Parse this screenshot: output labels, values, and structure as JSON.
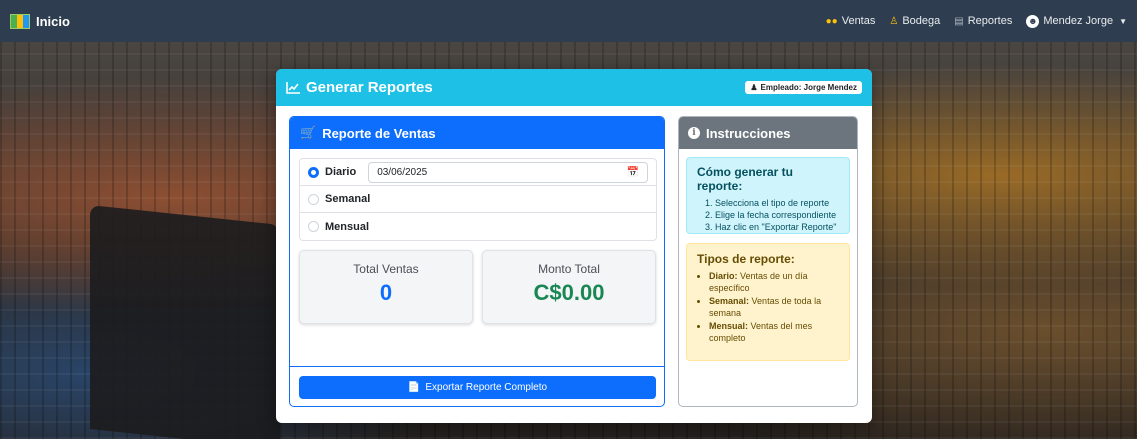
{
  "navbar": {
    "brand": "Inicio",
    "links": [
      {
        "label": "Ventas",
        "icon": "coins-icon"
      },
      {
        "label": "Bodega",
        "icon": "person-icon"
      },
      {
        "label": "Reportes",
        "icon": "chart-icon"
      }
    ],
    "user": "Mendez Jorge"
  },
  "card": {
    "title": "Generar Reportes",
    "employee_badge": "Empleado: Jorge Mendez"
  },
  "sales": {
    "title": "Reporte de Ventas",
    "options": [
      {
        "label": "Diario",
        "checked": true
      },
      {
        "label": "Semanal",
        "checked": false
      },
      {
        "label": "Mensual",
        "checked": false
      }
    ],
    "date_value": "03/06/2025",
    "total_label": "Total Ventas",
    "total_value": "0",
    "amount_label": "Monto Total",
    "amount_value": "C$0.00",
    "export_label": "Exportar Reporte Completo"
  },
  "instructions": {
    "title": "Instrucciones",
    "how_title": "Cómo generar tu reporte:",
    "steps": [
      "Selecciona el tipo de reporte",
      "Elige la fecha correspondiente",
      "Haz clic en \"Exportar Reporte\""
    ],
    "types_title": "Tipos de reporte:",
    "types": [
      {
        "name": "Diario:",
        "desc": "Ventas de un día específico"
      },
      {
        "name": "Semanal:",
        "desc": "Ventas de toda la semana"
      },
      {
        "name": "Mensual:",
        "desc": "Ventas del mes completo"
      }
    ]
  },
  "colors": {
    "navbar": "#2e3d4f",
    "header_cyan": "#1ec0e6",
    "primary": "#0d6efd",
    "secondary": "#6c757d",
    "success": "#198754"
  }
}
